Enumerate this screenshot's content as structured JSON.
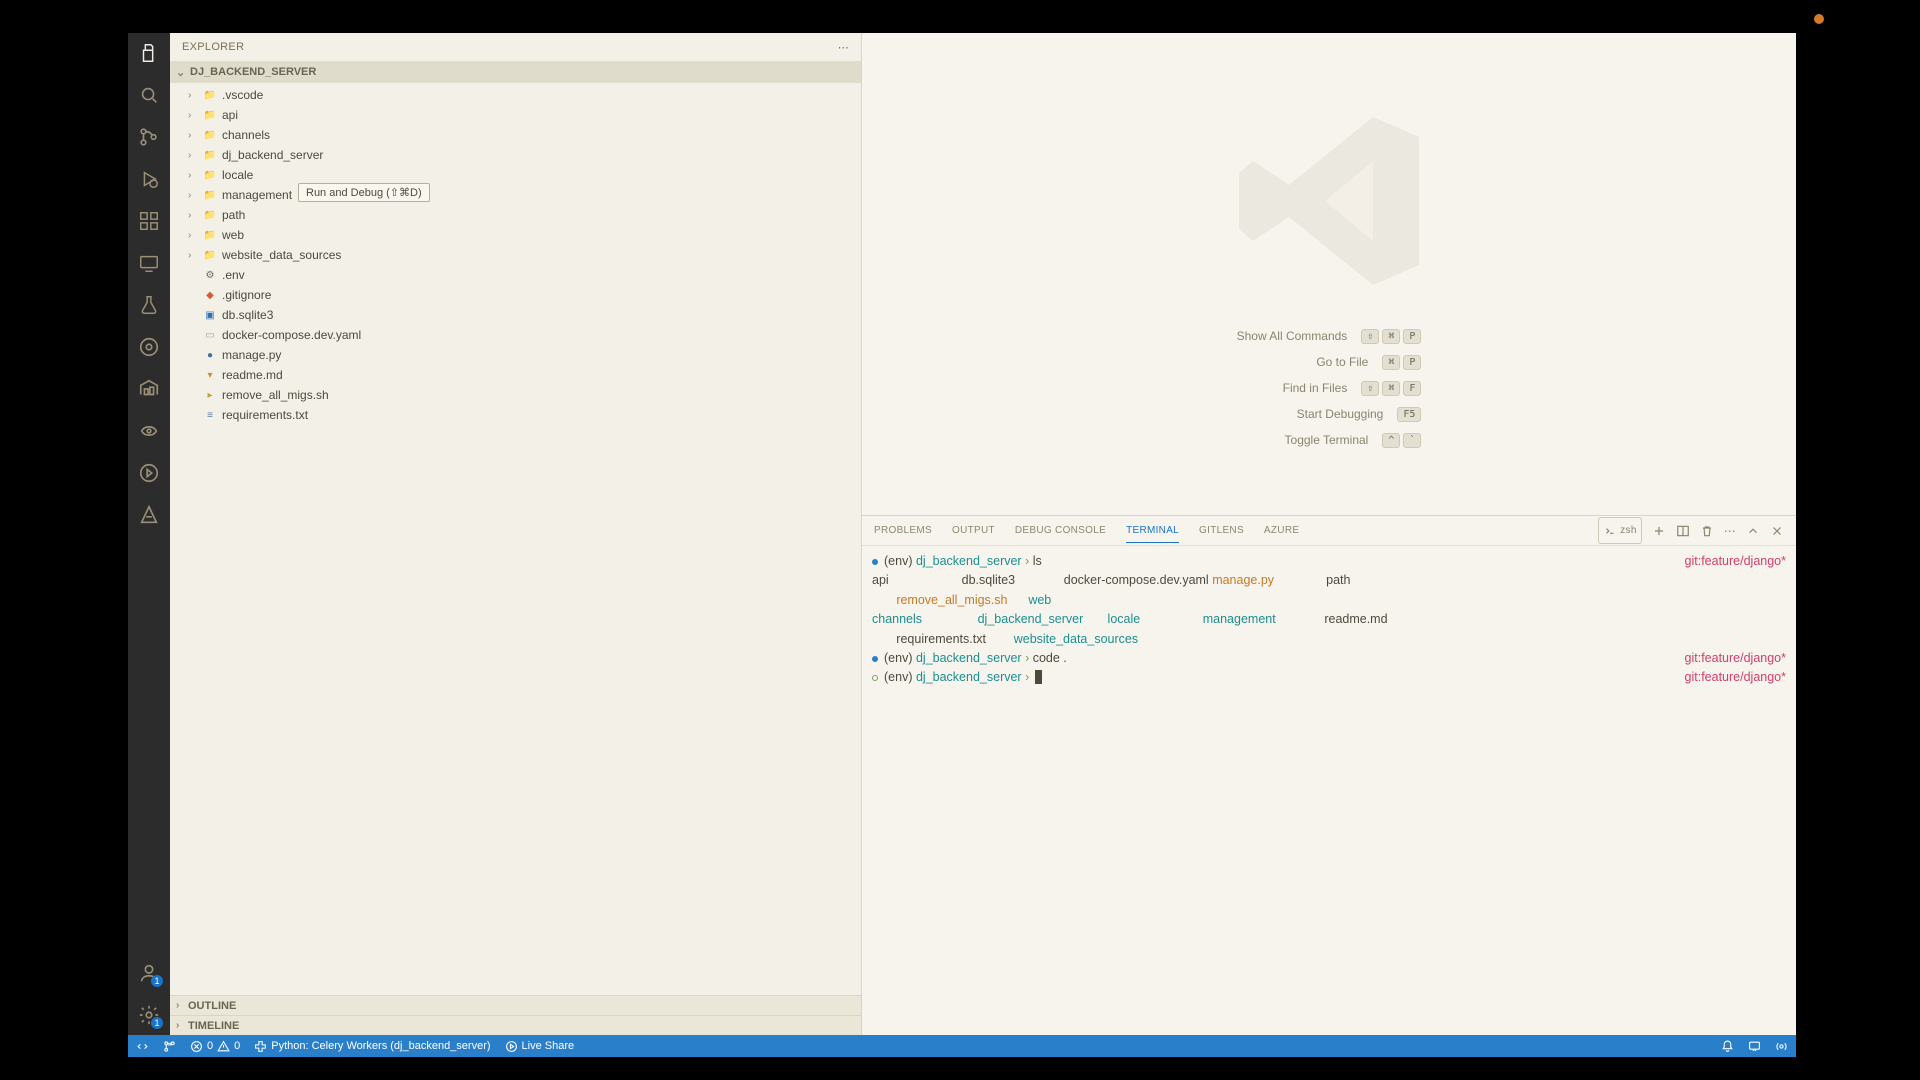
{
  "side_title": "EXPLORER",
  "root_name": "DJ_BACKEND_SERVER",
  "tooltip": "Run and Debug (⇧⌘D)",
  "folders": [
    {
      "name": ".vscode",
      "icon": "folder"
    },
    {
      "name": "api",
      "icon": "folder"
    },
    {
      "name": "channels",
      "icon": "folder"
    },
    {
      "name": "dj_backend_server",
      "icon": "folder"
    },
    {
      "name": "locale",
      "icon": "folder"
    },
    {
      "name": "management",
      "icon": "folder"
    },
    {
      "name": "path",
      "icon": "folder"
    },
    {
      "name": "web",
      "icon": "folder"
    },
    {
      "name": "website_data_sources",
      "icon": "folder"
    }
  ],
  "files": [
    {
      "name": ".env",
      "icon": "gear"
    },
    {
      "name": ".gitignore",
      "icon": "git"
    },
    {
      "name": "db.sqlite3",
      "icon": "sql"
    },
    {
      "name": "docker-compose.dev.yaml",
      "icon": "file"
    },
    {
      "name": "manage.py",
      "icon": "py"
    },
    {
      "name": "readme.md",
      "icon": "md"
    },
    {
      "name": "remove_all_migs.sh",
      "icon": "sh"
    },
    {
      "name": "requirements.txt",
      "icon": "txt"
    }
  ],
  "outline": "OUTLINE",
  "timeline": "TIMELINE",
  "cmds": [
    {
      "label": "Show All Commands",
      "keys": [
        "⇧",
        "⌘",
        "P"
      ]
    },
    {
      "label": "Go to File",
      "keys": [
        "⌘",
        "P"
      ]
    },
    {
      "label": "Find in Files",
      "keys": [
        "⇧",
        "⌘",
        "F"
      ]
    },
    {
      "label": "Start Debugging",
      "keys": [
        "F5"
      ]
    },
    {
      "label": "Toggle Terminal",
      "keys": [
        "^",
        "`"
      ]
    }
  ],
  "ptabs": [
    "PROBLEMS",
    "OUTPUT",
    "DEBUG CONSOLE",
    "TERMINAL",
    "GITLENS",
    "AZURE"
  ],
  "ptabs_active": "TERMINAL",
  "term_shell": "zsh",
  "term": {
    "env": "(env)",
    "dir": "dj_backend_server",
    "arrow": "›",
    "git": "git:feature/django*",
    "cmd1": "ls",
    "cmd2": "code .",
    "ls": {
      "r1": [
        "api",
        "db.sqlite3",
        "docker-compose.dev.yaml",
        "manage.py",
        "path"
      ],
      "r2a": "remove_all_migs.sh",
      "r2b": "web",
      "r3": [
        "channels",
        "dj_backend_server",
        "locale",
        "management",
        "readme.md"
      ],
      "r4a": "requirements.txt",
      "r4b": "website_data_sources"
    }
  },
  "status": {
    "branch": "⎇",
    "errors": "0",
    "warnings": "0",
    "python": "Python: Celery Workers (dj_backend_server)",
    "live": "Live Share"
  }
}
